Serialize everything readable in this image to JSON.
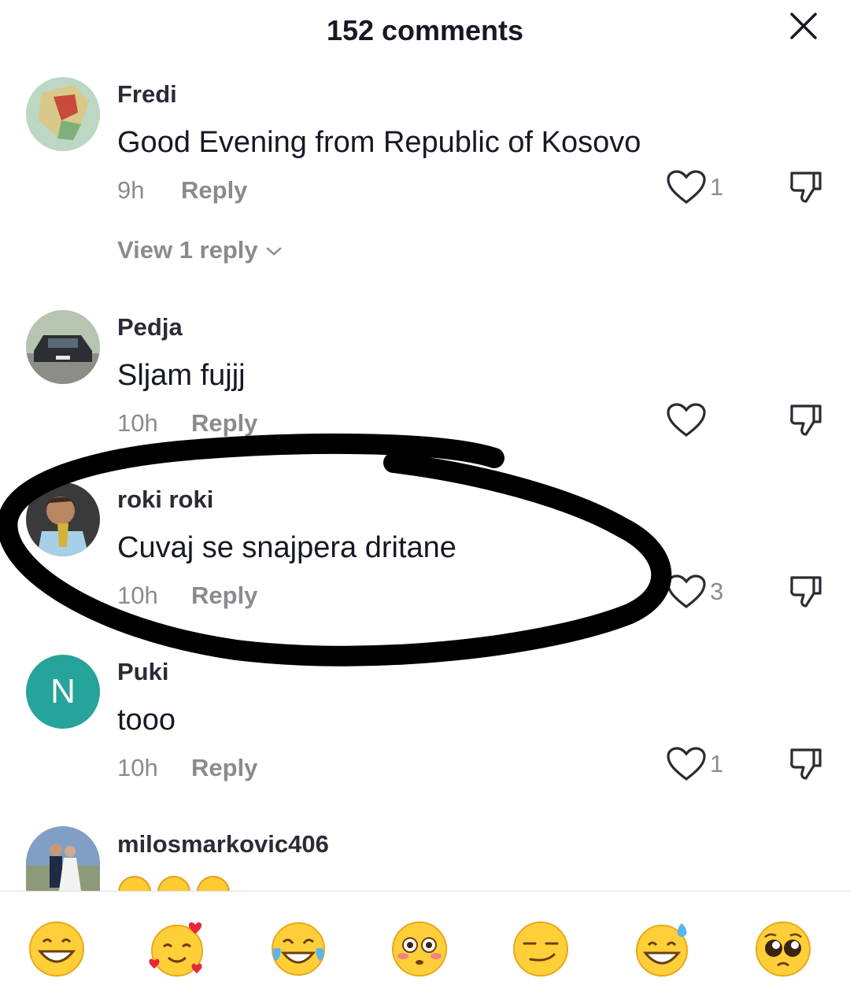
{
  "header": {
    "title": "152 comments",
    "close_icon": "close-icon"
  },
  "comments": [
    {
      "username": "Fredi",
      "text": "Good Evening from Republic of Kosovo",
      "time": "9h",
      "reply_label": "Reply",
      "likes": "1",
      "view_replies": "View 1 reply"
    },
    {
      "username": "Pedja",
      "text": "Sljam fujjj",
      "time": "10h",
      "reply_label": "Reply",
      "likes": ""
    },
    {
      "username": "roki roki",
      "text": "Cuvaj se snajpera dritane",
      "time": "10h",
      "reply_label": "Reply",
      "likes": "3"
    },
    {
      "username": "Puki",
      "avatar_letter": "N",
      "text": "tooo",
      "time": "10h",
      "reply_label": "Reply",
      "likes": "1"
    },
    {
      "username": "milosmarkovic406"
    }
  ],
  "emoji_bar": [
    "grinning-face",
    "smiling-face-with-hearts",
    "face-with-tears-of-joy",
    "flushed-face",
    "smirking-face",
    "grinning-face-with-sweat",
    "pleading-face"
  ],
  "colors": {
    "avatar_teal": "#26a39a",
    "muted_text": "#8a8b91",
    "primary_text": "#161823"
  }
}
